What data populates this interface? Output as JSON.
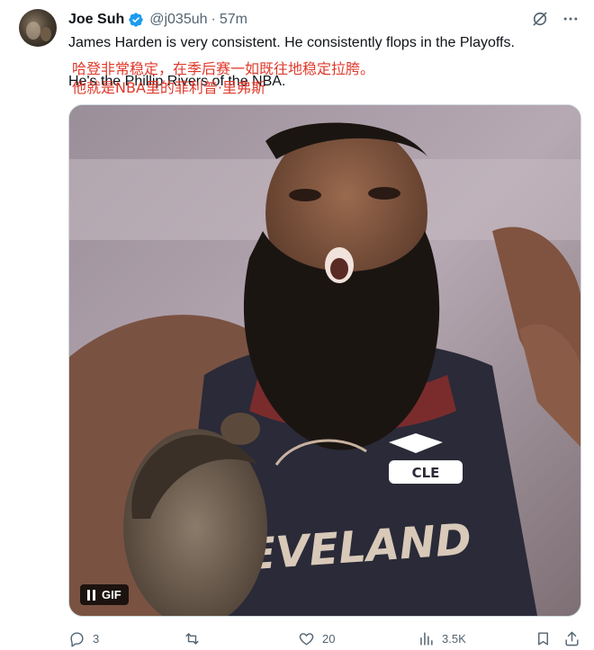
{
  "author": {
    "name": "Joe Suh",
    "handle": "@j035uh",
    "separator": "·",
    "time": "57m"
  },
  "tweet": {
    "text": "James Harden is very consistent. He consistently flops in the Playoffs.",
    "subline": "He's the Phillip Rivers of the NBA.",
    "overlay_line1": "哈登非常稳定，在季后赛一如既往地稳定拉胯。",
    "overlay_line2": "他就是NBA里的菲利普·里弗斯"
  },
  "media": {
    "badge": "GIF",
    "jersey_text": "CLEVELAND"
  },
  "actions": {
    "replies": "3",
    "reposts": "",
    "likes": "20",
    "views": "3.5K"
  },
  "colors": {
    "verified": "#1d9bf0",
    "muted": "#536471",
    "overlay_red": "#e0392b"
  }
}
